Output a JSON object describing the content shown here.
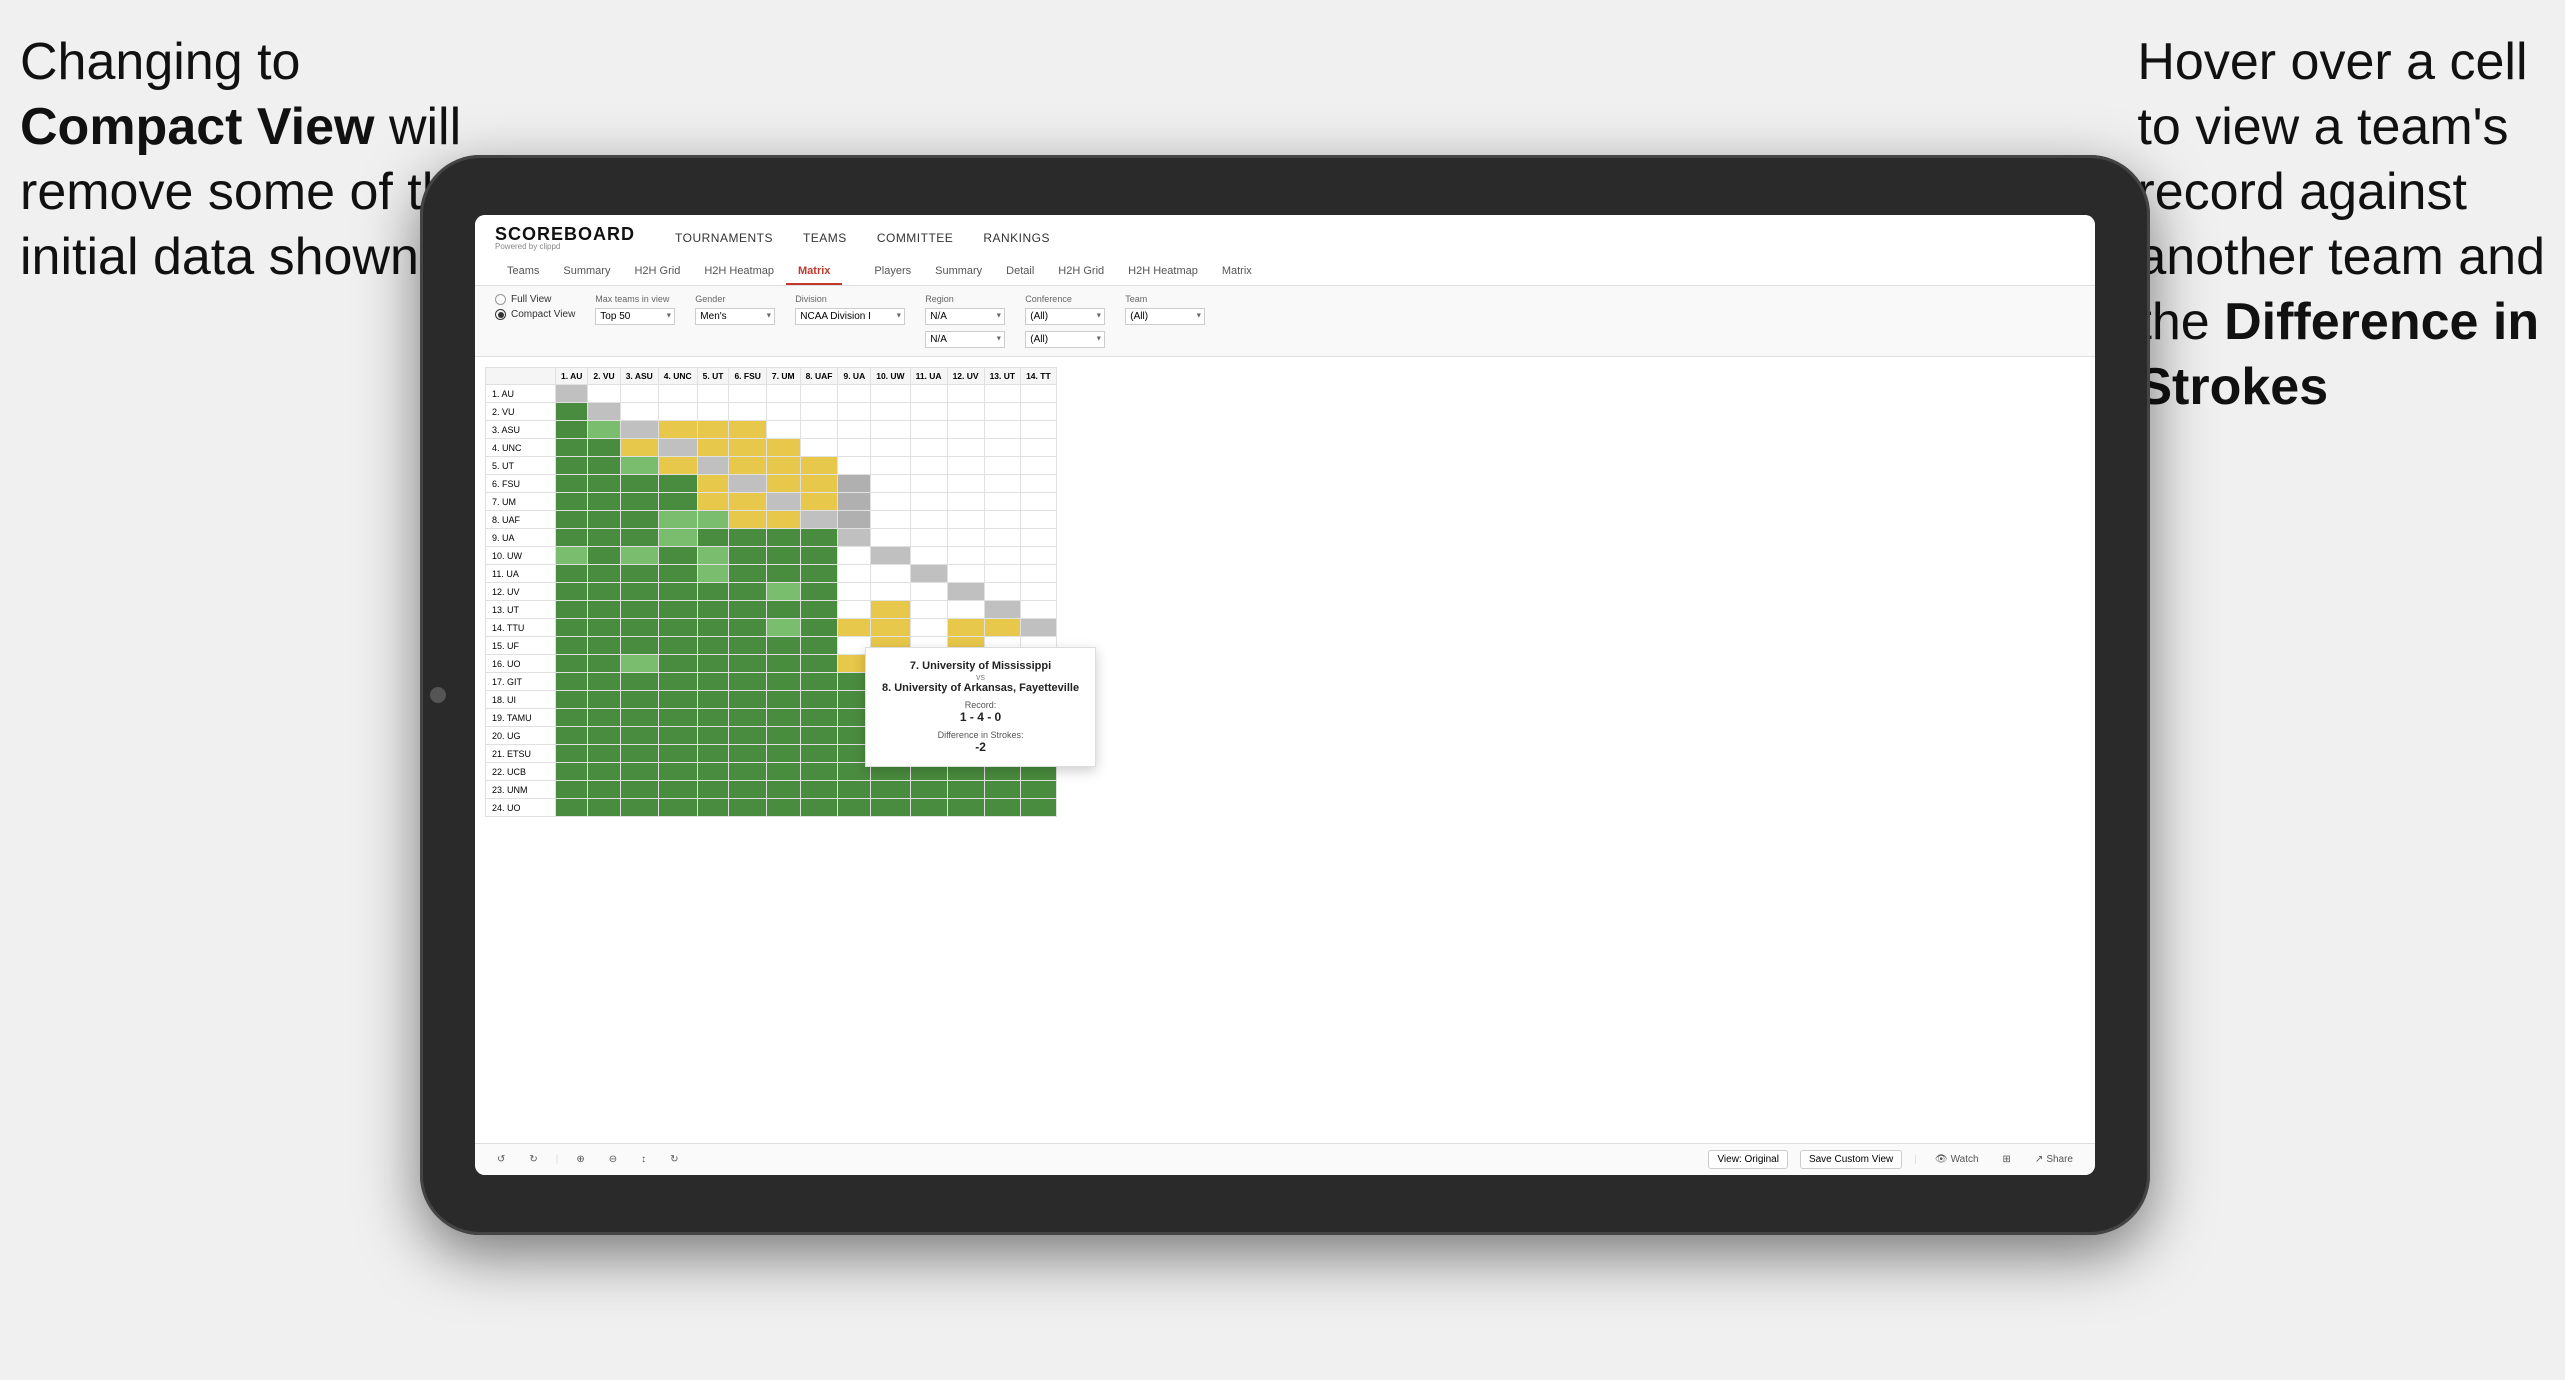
{
  "annotations": {
    "left_title": "Changing to",
    "left_bold": "Compact View",
    "left_text": " will\nremove some of the\ninitial data shown",
    "right_line1": "Hover over a cell",
    "right_line2": "to view a team's",
    "right_line3": "record against",
    "right_line4": "another team and",
    "right_line5": "the ",
    "right_bold": "Difference in",
    "right_bold2": "Strokes"
  },
  "nav": {
    "logo": "SCOREBOARD",
    "logo_sub": "Powered by clippd",
    "links": [
      "TOURNAMENTS",
      "TEAMS",
      "COMMITTEE",
      "RANKINGS"
    ]
  },
  "sub_nav": {
    "left_items": [
      "Teams",
      "Summary",
      "H2H Grid",
      "H2H Heatmap",
      "Matrix"
    ],
    "right_items": [
      "Players",
      "Summary",
      "Detail",
      "H2H Grid",
      "H2H Heatmap",
      "Matrix"
    ],
    "active": "Matrix"
  },
  "controls": {
    "view_full": "Full View",
    "view_compact": "Compact View",
    "view_selected": "compact",
    "max_teams_label": "Max teams in view",
    "max_teams_value": "Top 50",
    "gender_label": "Gender",
    "gender_value": "Men's",
    "division_label": "Division",
    "division_value": "NCAA Division I",
    "region_label": "Region",
    "region_value": "N/A",
    "conference_label": "Conference",
    "conference_values": [
      "(All)",
      "(All)"
    ],
    "team_label": "Team",
    "team_value": "(All)"
  },
  "col_headers": [
    "1. AU",
    "2. VU",
    "3. ASU",
    "4. UNC",
    "5. UT",
    "6. FSU",
    "7. UM",
    "8. UAF",
    "9. UA",
    "10. UW",
    "11. UA",
    "12. UV",
    "13. UT",
    "14. TT"
  ],
  "row_headers": [
    "1. AU",
    "2. VU",
    "3. ASU",
    "4. UNC",
    "5. UT",
    "6. FSU",
    "7. UM",
    "8. UAF",
    "9. UA",
    "10. UW",
    "11. UA",
    "12. UV",
    "13. UT",
    "14. TTU",
    "15. UF",
    "16. UO",
    "17. GIT",
    "18. UI",
    "19. TAMU",
    "20. UG",
    "21. ETSU",
    "22. UCB",
    "23. UNM",
    "24. UO"
  ],
  "tooltip": {
    "team1": "7. University of Mississippi",
    "vs": "vs",
    "team2": "8. University of Arkansas, Fayetteville",
    "record_label": "Record:",
    "record": "1 - 4 - 0",
    "diff_label": "Difference in Strokes:",
    "diff": "-2"
  },
  "toolbar": {
    "undo": "↺",
    "redo": "↻",
    "icon1": "⊕",
    "icon2": "⊖",
    "icon3": "↕",
    "icon4": "↻",
    "view_original": "View: Original",
    "save_custom": "Save Custom View",
    "watch": "Watch",
    "share": "Share"
  }
}
